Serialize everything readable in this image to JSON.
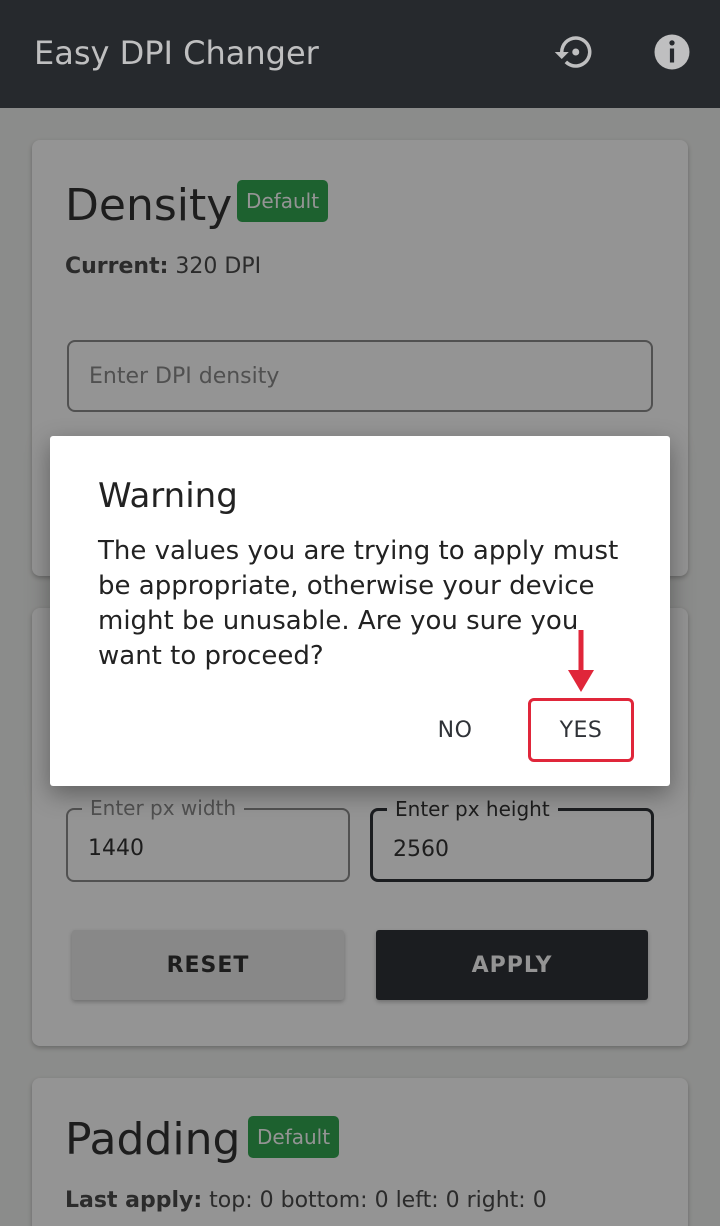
{
  "app": {
    "title": "Easy DPI Changer",
    "icons": {
      "reset": "history-icon",
      "info": "info-icon"
    }
  },
  "density": {
    "heading": "Density",
    "badge": "Default",
    "current_label": "Current:",
    "current_value": "320 DPI",
    "input_placeholder": "Enter DPI density"
  },
  "resolution": {
    "width_label": "Enter px width",
    "width_value": "1440",
    "height_label": "Enter px height",
    "height_value": "2560",
    "reset_label": "RESET",
    "apply_label": "APPLY"
  },
  "padding": {
    "heading": "Padding",
    "badge": "Default",
    "last_label": "Last apply:",
    "last_value": "top: 0 bottom: 0 left: 0 right: 0"
  },
  "dialog": {
    "title": "Warning",
    "message": "The values you are trying to apply must be appropriate, otherwise your device might be unusable. Are you sure you want to proceed?",
    "no_label": "NO",
    "yes_label": "YES"
  },
  "colors": {
    "appbar": "#2f3237",
    "badge": "#32a852",
    "highlight": "#e0263a"
  }
}
